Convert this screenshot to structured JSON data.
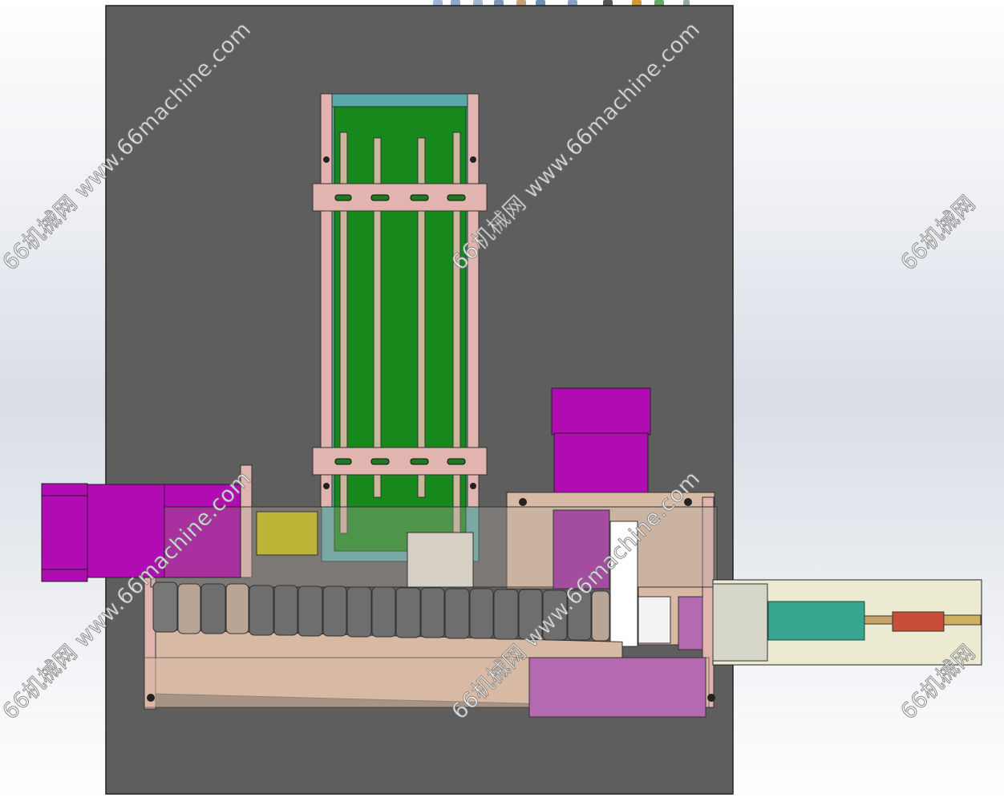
{
  "toolbar": {
    "icons": [
      "zoom-fit-icon",
      "zoom-area-icon",
      "previous-view-icon",
      "section-view-icon",
      "view-orientation-icon",
      "display-style-icon",
      "hide-show-icon",
      "edit-appearance-icon",
      "apply-scene-icon",
      "view-settings-icon"
    ]
  },
  "watermarks": [
    "66机械网 www.66machine.com",
    "66机械网 www.66machine.com",
    "66机械网",
    "66机械网 www.66machine.com",
    "66机械网 www.66machine.com",
    "66机械网"
  ],
  "colors": {
    "base_plate": "#5e5e5e",
    "conveyor_belt": "#17891c",
    "belt_frame": "#5aa8a8",
    "side_plate": "#e2b4b0",
    "motor": "#b10cb4",
    "frame": "#d8b9a3",
    "roller": "#6e6e6e",
    "cylinder_housing": "#ecebd2",
    "cylinder_rod": "#38a58e",
    "cylinder_tip": "#c84e38",
    "sensor": "#bcb638"
  }
}
